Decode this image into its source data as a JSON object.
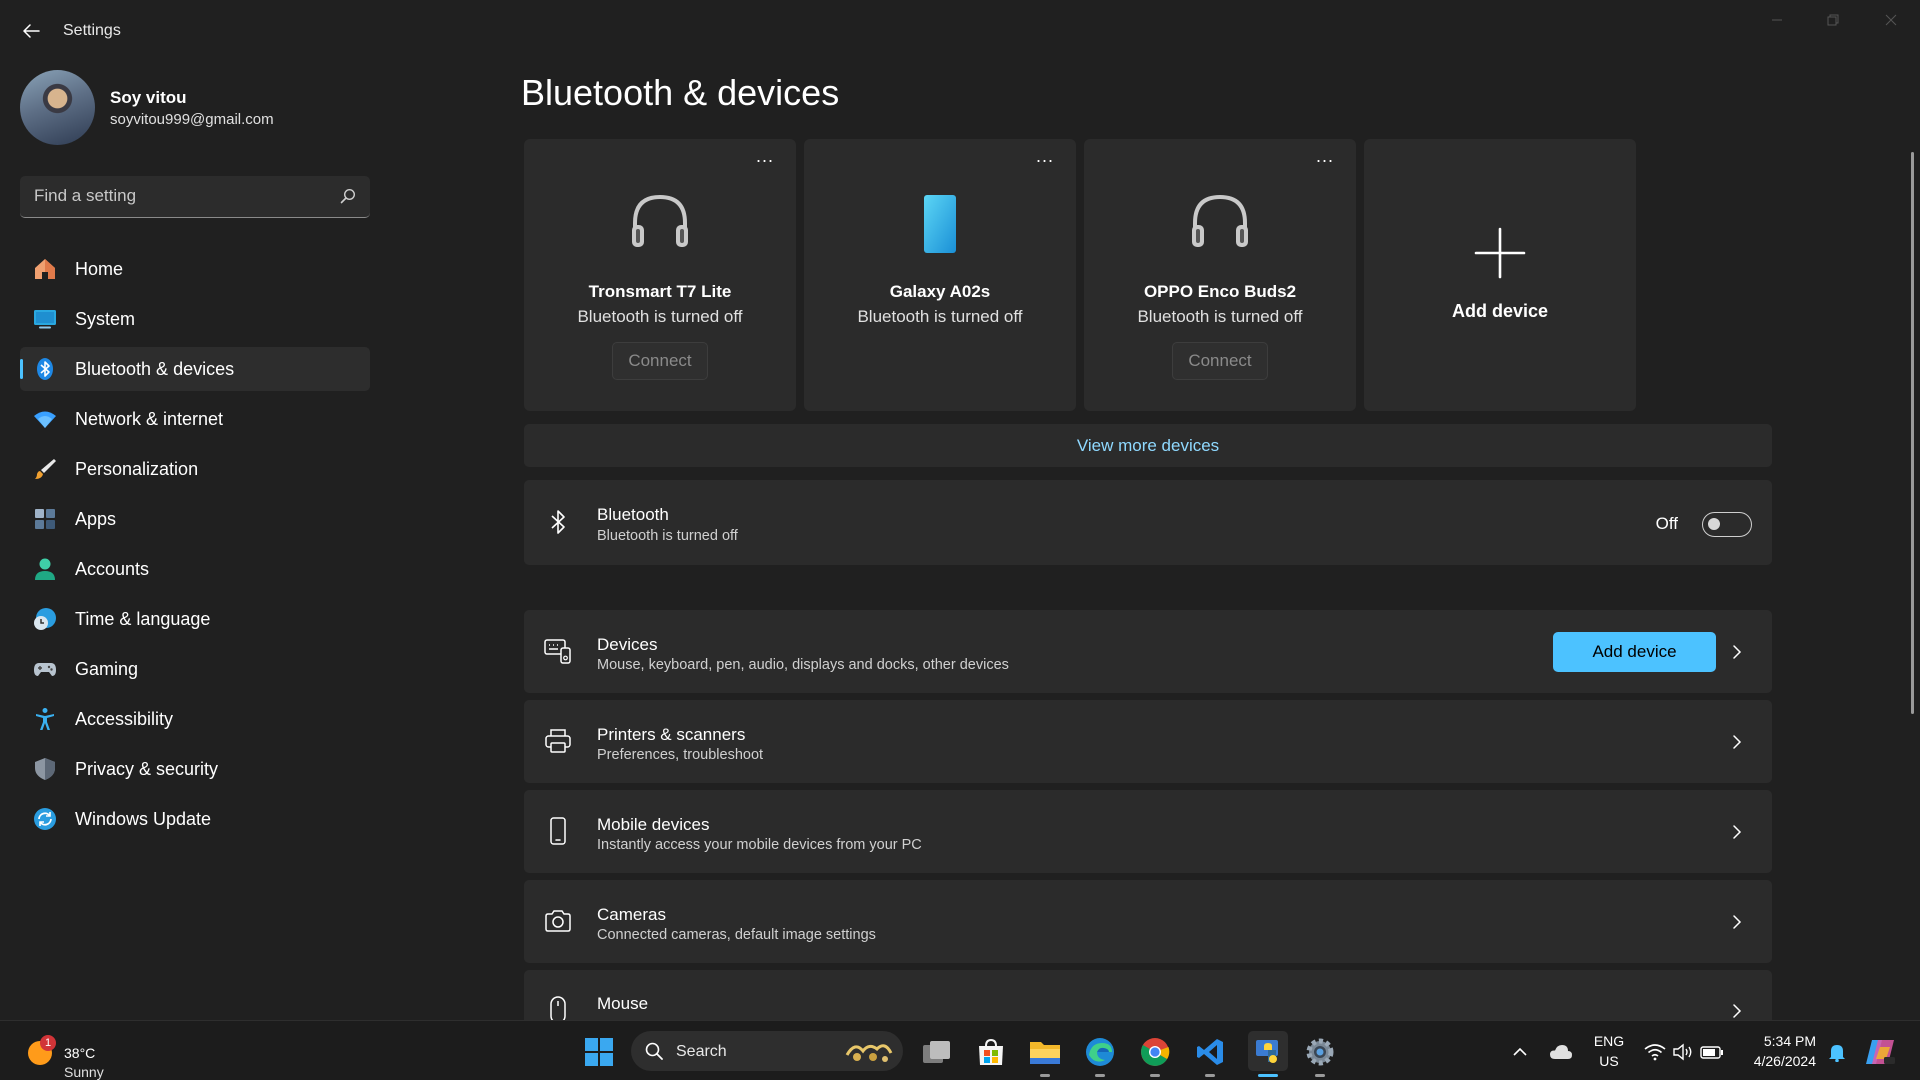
{
  "window": {
    "title": "Settings"
  },
  "profile": {
    "name": "Soy vitou",
    "email": "soyvitou999@gmail.com"
  },
  "search": {
    "placeholder": "Find a setting"
  },
  "sidebar": {
    "items": [
      {
        "label": "Home",
        "icon": "home-icon"
      },
      {
        "label": "System",
        "icon": "system-icon"
      },
      {
        "label": "Bluetooth & devices",
        "icon": "bluetooth-icon",
        "active": true
      },
      {
        "label": "Network & internet",
        "icon": "wifi-icon"
      },
      {
        "label": "Personalization",
        "icon": "brush-icon"
      },
      {
        "label": "Apps",
        "icon": "apps-icon"
      },
      {
        "label": "Accounts",
        "icon": "accounts-icon"
      },
      {
        "label": "Time & language",
        "icon": "clock-globe-icon"
      },
      {
        "label": "Gaming",
        "icon": "gamepad-icon"
      },
      {
        "label": "Accessibility",
        "icon": "accessibility-icon"
      },
      {
        "label": "Privacy & security",
        "icon": "shield-icon"
      },
      {
        "label": "Windows Update",
        "icon": "update-icon"
      }
    ]
  },
  "main": {
    "title": "Bluetooth & devices",
    "devices": [
      {
        "name": "Tronsmart T7 Lite",
        "status": "Bluetooth is turned off",
        "connect_label": "Connect",
        "icon": "headphones-icon"
      },
      {
        "name": "Galaxy A02s",
        "status": "Bluetooth is turned off",
        "icon": "phone-icon"
      },
      {
        "name": "OPPO Enco Buds2",
        "status": "Bluetooth is turned off",
        "connect_label": "Connect",
        "icon": "headphones-icon"
      }
    ],
    "more_label": "...",
    "add_device_card_label": "Add device",
    "view_more_label": "View more devices",
    "bluetooth": {
      "title": "Bluetooth",
      "subtitle": "Bluetooth is turned off",
      "toggle_label": "Off",
      "enabled": false
    },
    "rows": [
      {
        "title": "Devices",
        "subtitle": "Mouse, keyboard, pen, audio, displays and docks, other devices",
        "button_label": "Add device",
        "icon": "devices-icon"
      },
      {
        "title": "Printers & scanners",
        "subtitle": "Preferences, troubleshoot",
        "icon": "printer-icon"
      },
      {
        "title": "Mobile devices",
        "subtitle": "Instantly access your mobile devices from your PC",
        "icon": "mobile-icon"
      },
      {
        "title": "Cameras",
        "subtitle": "Connected cameras, default image settings",
        "icon": "camera-icon"
      },
      {
        "title": "Mouse",
        "icon": "mouse-icon"
      }
    ]
  },
  "taskbar": {
    "weather": {
      "temp": "38°C",
      "condition": "Sunny",
      "badge": "1"
    },
    "search_label": "Search",
    "language": {
      "line1": "ENG",
      "line2": "US"
    },
    "time": "5:34 PM",
    "date": "4/26/2024"
  },
  "colors": {
    "accent": "#4cc2ff",
    "background": "#202020",
    "card": "#2b2b2b"
  }
}
